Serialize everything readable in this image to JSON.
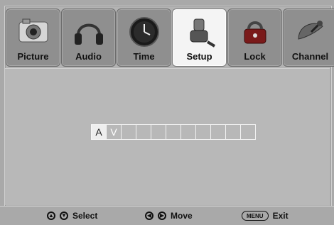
{
  "tabs": [
    {
      "label": "Picture",
      "icon": "camera-icon"
    },
    {
      "label": "Audio",
      "icon": "headphones-icon"
    },
    {
      "label": "Time",
      "icon": "clock-icon"
    },
    {
      "label": "Setup",
      "icon": "tools-icon",
      "active": true
    },
    {
      "label": "Lock",
      "icon": "lock-icon"
    },
    {
      "label": "Channel",
      "icon": "satellite-dish-icon"
    }
  ],
  "name_input": {
    "chars": [
      "A",
      "V",
      "",
      "",
      "",
      "",
      "",
      "",
      "",
      "",
      ""
    ],
    "active_index": 0
  },
  "footer": {
    "select_label": "Select",
    "move_label": "Move",
    "menu_key": "MENU",
    "exit_label": "Exit"
  }
}
